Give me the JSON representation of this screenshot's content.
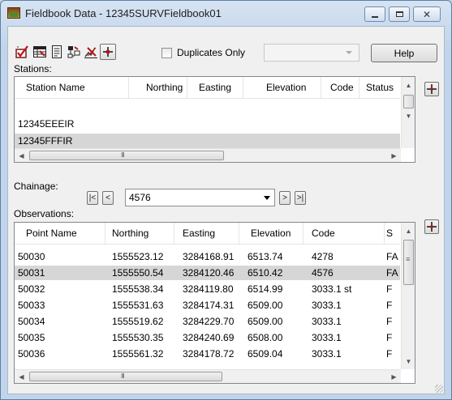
{
  "window": {
    "title": "Fieldbook Data - 12345SURVFieldbook01",
    "minimize_icon": "minimize-icon",
    "maximize_icon": "maximize-icon",
    "close_icon": "close-icon"
  },
  "toolbar": {
    "icons": [
      "check-icon",
      "table-icon",
      "document-icon",
      "tree-icon",
      "pencil-icon",
      "crosshair-icon"
    ],
    "duplicates_label": "Duplicates Only",
    "duplicates_checked": false,
    "filter_value": "",
    "help_label": "Help"
  },
  "stations": {
    "label": "Stations:",
    "columns": [
      "Station Name",
      "Northing",
      "Easting",
      "Elevation",
      "Code",
      "Status"
    ],
    "rows": [
      {
        "name": "12345EEEIR",
        "selected": false
      },
      {
        "name": "12345FFFIR",
        "selected": true
      }
    ],
    "add_icon": "crosshair-add-icon"
  },
  "chainage": {
    "label": "Chainage:",
    "value": "4576",
    "first_label": "|<",
    "prev_label": "<",
    "next_label": ">",
    "last_label": ">|"
  },
  "observations": {
    "label": "Observations:",
    "columns": [
      "Point Name",
      "Northing",
      "Easting",
      "Elevation",
      "Code",
      "S"
    ],
    "rows": [
      [
        "50030",
        "1555523.12",
        "3284168.91",
        "6513.74",
        "4278",
        "FA"
      ],
      [
        "50031",
        "1555550.54",
        "3284120.46",
        "6510.42",
        "4576",
        "FA"
      ],
      [
        "50032",
        "1555538.34",
        "3284119.80",
        "6514.99",
        "3033.1 st",
        "F"
      ],
      [
        "50033",
        "1555531.63",
        "3284174.31",
        "6509.00",
        "3033.1",
        "F"
      ],
      [
        "50034",
        "1555519.62",
        "3284229.70",
        "6509.00",
        "3033.1",
        "F"
      ],
      [
        "50035",
        "1555530.35",
        "3284240.69",
        "6508.00",
        "3033.1",
        "F"
      ],
      [
        "50036",
        "1555561.32",
        "3284178.72",
        "6509.04",
        "3033.1",
        "F"
      ]
    ],
    "selected_index": 1,
    "add_icon": "crosshair-add-icon"
  },
  "colors": {
    "selection": "#d6d6d6",
    "title_bg": "#c5d6ea"
  }
}
